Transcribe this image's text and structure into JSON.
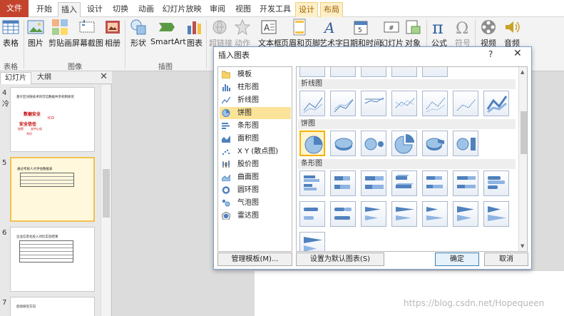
{
  "ribbon_tabs": {
    "file": "文件",
    "home": "开始",
    "insert": "插入",
    "design": "设计",
    "transitions": "切换",
    "animations": "动画",
    "slideshow": "幻灯片放映",
    "review": "审阅",
    "view": "视图",
    "developer": "开发工具",
    "ctx_design": "设计",
    "ctx_layout": "布局"
  },
  "ribbon": {
    "table": "表格",
    "picture": "图片",
    "clipart": "剪贴画",
    "screenshot": "屏幕截图",
    "album": "相册",
    "shapes": "形状",
    "smartart": "SmartArt",
    "chart": "图表",
    "hyperlink": "超链接",
    "action": "动作",
    "textbox": "文本框",
    "header_footer": "页眉和页脚",
    "wordart": "艺术字",
    "datetime": "日期和时间",
    "slide_number": "幻灯片",
    "object": "对象",
    "equation": "公式",
    "symbol": "符号",
    "video": "视频",
    "audio": "音频",
    "group_tables": "表格",
    "group_images": "图像",
    "group_illustrations": "插图"
  },
  "slide_panel": {
    "tab_slides": "幻灯片",
    "tab_outline": "大纲",
    "close": "✕",
    "slides": [
      {
        "num": "4",
        "side": "冷",
        "title": "基于区块链技术的可信数据共享机制研究"
      },
      {
        "num": "5",
        "title": "通过考核人才评估数据表"
      },
      {
        "num": "6",
        "title": "企业信息化投入对比实验结果"
      },
      {
        "num": "7",
        "title": "后续研究方向"
      }
    ],
    "slide4_words": [
      "数据安全",
      "ICO",
      "安全信任",
      "加密",
      "去中心化",
      "共识"
    ]
  },
  "dialog": {
    "title": "插入图表",
    "help": "?",
    "close": "✕",
    "categories": [
      {
        "label": "模板",
        "icon": "folder-icon"
      },
      {
        "label": "柱形图",
        "icon": "column-chart-icon"
      },
      {
        "label": "折线图",
        "icon": "line-chart-icon"
      },
      {
        "label": "饼图",
        "icon": "pie-chart-icon",
        "selected": true
      },
      {
        "label": "条形图",
        "icon": "bar-chart-icon"
      },
      {
        "label": "面积图",
        "icon": "area-chart-icon"
      },
      {
        "label": "X Y (散点图)",
        "icon": "scatter-chart-icon"
      },
      {
        "label": "股价图",
        "icon": "stock-chart-icon"
      },
      {
        "label": "曲面图",
        "icon": "surface-chart-icon"
      },
      {
        "label": "圆环图",
        "icon": "doughnut-chart-icon"
      },
      {
        "label": "气泡图",
        "icon": "bubble-chart-icon"
      },
      {
        "label": "雷达图",
        "icon": "radar-chart-icon"
      }
    ],
    "section_line": "折线图",
    "section_pie": "饼图",
    "section_bar": "条形图",
    "manage_templates": "管理模板(M)...",
    "set_default": "设置为默认图表(S)",
    "ok": "确定",
    "cancel": "取消"
  },
  "watermark": "https://blog.csdn.net/Hopequeen",
  "colors": {
    "file_tab": "#c4432c",
    "selection": "#fce39a",
    "gallery_selected_border": "#f4b400",
    "chart_blue": "#4f81bd"
  }
}
